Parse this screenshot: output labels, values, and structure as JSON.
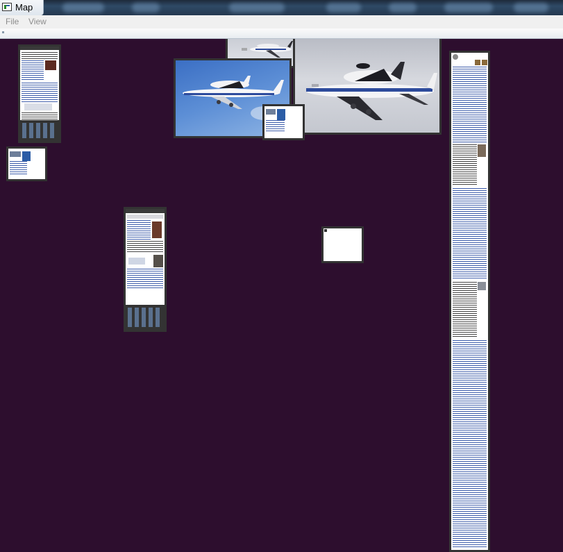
{
  "window": {
    "title": "Map",
    "icon": "map-app-icon"
  },
  "menu": {
    "file": "File",
    "view": "View"
  },
  "colors": {
    "canvas_background": "#2d0e2e",
    "thumbnail_frame": "#333333",
    "link_blue": "#1a3f9b"
  },
  "canvas": {
    "thumbnails": [
      {
        "id": "webpage-thumb-1",
        "kind": "webpage"
      },
      {
        "id": "webpage-thumb-2",
        "kind": "webpage-small"
      },
      {
        "id": "shuttle-photo-top",
        "kind": "photo"
      },
      {
        "id": "shuttle-photo-left",
        "kind": "photo"
      },
      {
        "id": "shuttle-photo-right",
        "kind": "photo"
      },
      {
        "id": "webpage-thumb-3",
        "kind": "webpage-small"
      },
      {
        "id": "webpage-thumb-4",
        "kind": "webpage"
      },
      {
        "id": "blank-thumb",
        "kind": "blank"
      },
      {
        "id": "webpage-thumb-long",
        "kind": "webpage-long"
      }
    ]
  }
}
